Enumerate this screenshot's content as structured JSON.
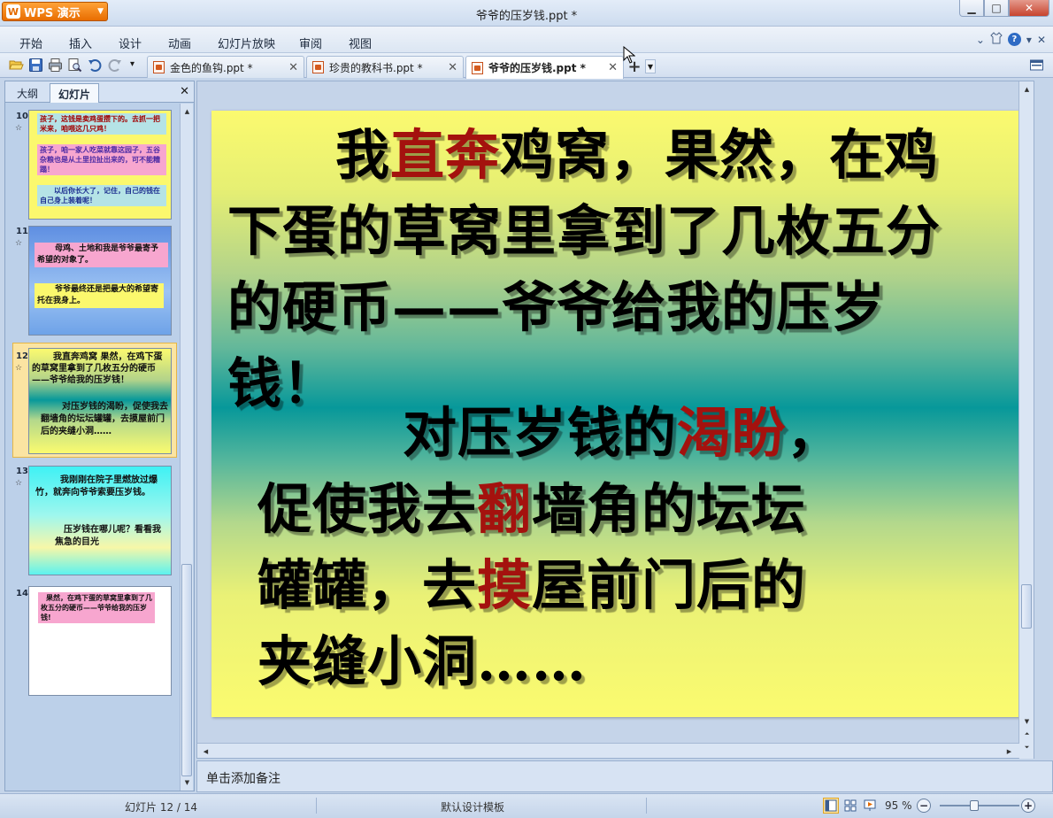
{
  "app": {
    "button_label": "WPS 演示",
    "window_title": "爷爷的压岁钱.ppt *",
    "controls": {
      "minimize": "▁",
      "maximize": "□",
      "close": "✕"
    }
  },
  "menu": {
    "items": [
      "开始",
      "插入",
      "设计",
      "动画",
      "幻灯片放映",
      "审阅",
      "视图"
    ]
  },
  "doc_tabs": [
    {
      "label": "金色的鱼钩.ppt *",
      "active": false
    },
    {
      "label": "珍贵的教科书.ppt *",
      "active": false
    },
    {
      "label": "爷爷的压岁钱.ppt *",
      "active": true
    }
  ],
  "left_panel": {
    "tabs": [
      "大纲",
      "幻灯片"
    ],
    "active_tab": "幻灯片",
    "thumbnails": [
      {
        "number": "10",
        "star": "☆",
        "lines": [
          "孩子，这钱是卖鸡蛋攒下的。去抓一把米来，咱喂这几只鸡！",
          "孩子，咱一家人吃菜就靠这园子，五谷杂粮也是从土里拉扯出来的，可不能糟蹋！",
          "以后你长大了，记住，自己的钱在自己身上装着呢！"
        ]
      },
      {
        "number": "11",
        "star": "☆",
        "lines": [
          "母鸡、土地和我是爷爷最寄予希望的对象了。",
          "爷爷最终还是把最大的希望寄托在我身上。"
        ]
      },
      {
        "number": "12",
        "star": "☆",
        "lines": [
          "我直奔鸡窝 果然，在鸡下蛋的草窝里拿到了几枚五分的硬币——爷爷给我的压岁钱！",
          "对压岁钱的渴盼，促使我去翻墙角的坛坛罐罐，去摸屋前门后的夹缝小洞……"
        ]
      },
      {
        "number": "13",
        "star": "☆",
        "lines": [
          "我刚刚在院子里燃放过爆竹，就奔向爷爷索要压岁钱。",
          "压岁钱在哪儿呢？看看我焦急的目光"
        ]
      },
      {
        "number": "14",
        "star": "",
        "lines": [
          "果然，在鸡下蛋的草窝里拿到了几枚五分的硬币——爷爷给我的压岁钱!"
        ]
      }
    ]
  },
  "slide": {
    "p1_a": "我",
    "p1_red": "直奔",
    "p1_b": "鸡窝，果然，在鸡",
    "p1_line2": "下蛋的草窝里拿到了几枚五分",
    "p1_line3": "的硬币——爷爷给我的压岁",
    "p1_line4": "钱！",
    "p2_a": "对压岁钱的",
    "p2_red": "渴盼",
    "p2_b": "，",
    "p2_l2a": "促使我去",
    "p2_l2red": "翻",
    "p2_l2b": "墙角的坛坛",
    "p2_l3a": "罐罐，去",
    "p2_l3red": "摸",
    "p2_l3b": "屋前门后的",
    "p2_l4": "夹缝小洞……"
  },
  "notes": {
    "placeholder": "单击添加备注"
  },
  "status": {
    "slide_indicator": "幻灯片 12 / 14",
    "template": "默认设计模板",
    "zoom": "95 %",
    "zoom_level_percent": 95
  },
  "colors": {
    "accent_orange": "#e86d00",
    "slide_red": "#a4120e",
    "slide_yellow": "#fbfa6f",
    "slide_teal": "#07989a"
  }
}
